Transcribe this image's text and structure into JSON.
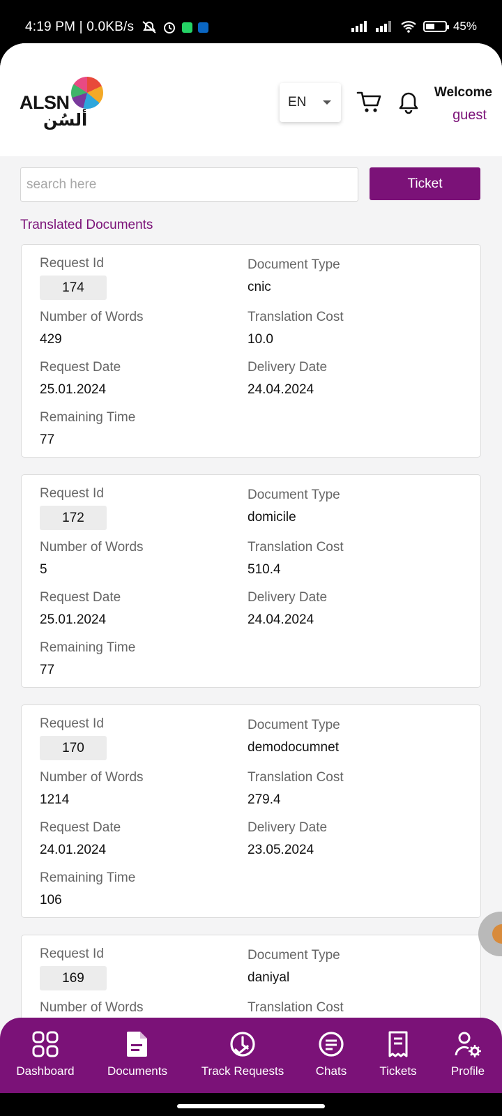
{
  "status_bar": {
    "time": "4:19 PM | 0.0KB/s",
    "battery": "45%",
    "battery_level": 0.45
  },
  "header": {
    "logo_text": "ALSN",
    "logo_arabic": "ألسُن",
    "language": "EN",
    "welcome_title": "Welcome",
    "welcome_user": "guest"
  },
  "search": {
    "placeholder": "search here",
    "value": ""
  },
  "ticket_button": "Ticket",
  "section_title": "Translated Documents",
  "labels": {
    "request_id": "Request Id",
    "document_type": "Document Type",
    "number_of_words": "Number of Words",
    "translation_cost": "Translation Cost",
    "request_date": "Request Date",
    "delivery_date": "Delivery Date",
    "remaining_time": "Remaining Time"
  },
  "documents": [
    {
      "request_id": "174",
      "document_type": "cnic",
      "number_of_words": "429",
      "translation_cost": "10.0",
      "request_date": "25.01.2024",
      "delivery_date": "24.04.2024",
      "remaining_time": "77"
    },
    {
      "request_id": "172",
      "document_type": "domicile",
      "number_of_words": "5",
      "translation_cost": "510.4",
      "request_date": "25.01.2024",
      "delivery_date": "24.04.2024",
      "remaining_time": "77"
    },
    {
      "request_id": "170",
      "document_type": "demodocumnet",
      "number_of_words": "1214",
      "translation_cost": "279.4",
      "request_date": "24.01.2024",
      "delivery_date": "23.05.2024",
      "remaining_time": "106"
    },
    {
      "request_id": "169",
      "document_type": "daniyal",
      "number_of_words": "",
      "translation_cost": "",
      "request_date": "",
      "delivery_date": "",
      "remaining_time": ""
    }
  ],
  "bottom_nav": [
    {
      "label": "Dashboard",
      "icon": "grid-icon"
    },
    {
      "label": "Documents",
      "icon": "document-icon",
      "active": true
    },
    {
      "label": "Track Requests",
      "icon": "track-icon"
    },
    {
      "label": "Chats",
      "icon": "chat-icon"
    },
    {
      "label": "Tickets",
      "icon": "receipt-icon"
    },
    {
      "label": "Profile",
      "icon": "profile-settings-icon"
    }
  ],
  "colors": {
    "brand": "#7b1278",
    "background": "#f4f4f5"
  }
}
